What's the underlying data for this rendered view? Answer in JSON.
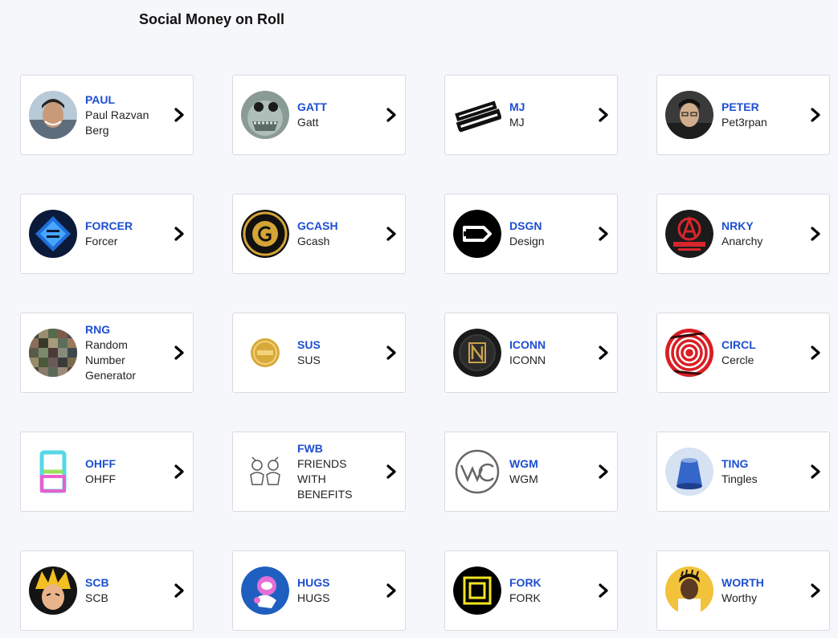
{
  "page": {
    "title": "Social Money on Roll"
  },
  "coins": [
    {
      "symbol": "PAUL",
      "name": "Paul Razvan Berg",
      "icon": "person-avatar-icon"
    },
    {
      "symbol": "GATT",
      "name": "Gatt",
      "icon": "creature-avatar-icon"
    },
    {
      "symbol": "MJ",
      "name": "MJ",
      "icon": "came-from-nuffin-logo-icon"
    },
    {
      "symbol": "PETER",
      "name": "Pet3rpan",
      "icon": "person-avatar-icon"
    },
    {
      "symbol": "FORCER",
      "name": "Forcer",
      "icon": "blue-crystal-logo-icon"
    },
    {
      "symbol": "GCASH",
      "name": "Gcash",
      "icon": "gold-g-coin-icon"
    },
    {
      "symbol": "DSGN",
      "name": "Design",
      "icon": "design-logo-icon"
    },
    {
      "symbol": "NRKY",
      "name": "Anarchy",
      "icon": "anarchist-gaming-logo-icon"
    },
    {
      "symbol": "RNG",
      "name": "Random Number Generator",
      "icon": "pixel-noise-icon"
    },
    {
      "symbol": "SUS",
      "name": "SUS",
      "icon": "gold-coin-icon"
    },
    {
      "symbol": "ICONN",
      "name": "ICONN",
      "icon": "iconn-logo-icon"
    },
    {
      "symbol": "CIRCL",
      "name": "Cercle",
      "icon": "red-concentric-circles-icon"
    },
    {
      "symbol": "OHFF",
      "name": "OHFF",
      "icon": "ohff-logo-icon"
    },
    {
      "symbol": "FWB",
      "name": "FRIENDS WITH BENEFITS",
      "icon": "fwb-illustration-icon"
    },
    {
      "symbol": "WGM",
      "name": "WGM",
      "icon": "wgm-logo-icon"
    },
    {
      "symbol": "TING",
      "name": "Tingles",
      "icon": "blue-object-icon"
    },
    {
      "symbol": "SCB",
      "name": "SCB",
      "icon": "anime-character-icon"
    },
    {
      "symbol": "HUGS",
      "name": "HUGS",
      "icon": "astronaut-illustration-icon"
    },
    {
      "symbol": "FORK",
      "name": "FORK",
      "icon": "yellow-square-logo-icon"
    },
    {
      "symbol": "WORTH",
      "name": "Worthy",
      "icon": "person-avatar-icon"
    }
  ],
  "colors": {
    "symbol": "#1d4fd1",
    "text": "#222222",
    "background": "#f6f7fb",
    "card_border": "#d9dbe1"
  }
}
